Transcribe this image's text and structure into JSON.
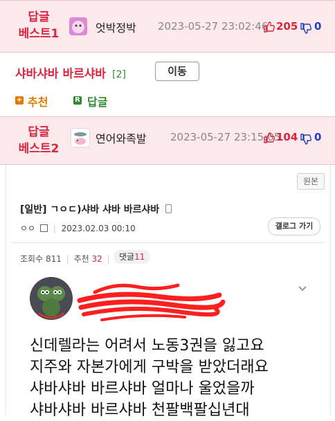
{
  "best1": {
    "label_line1": "답글",
    "label_line2": "베스트1",
    "nickname": "엇박정박",
    "datetime": "2023-05-27 23:02:46",
    "up": "205",
    "down": "0"
  },
  "thread": {
    "title": "샤바샤바 바르샤바",
    "reply_count": "[2]",
    "move_button": "이동",
    "recommend_label": "추천",
    "reply_label": "답글",
    "recommend_badge": "+",
    "reply_badge": "R"
  },
  "best2": {
    "label_line1": "답글",
    "label_line2": "베스트2",
    "nickname": "연어와족발",
    "datetime": "2023-05-27 23:15:05",
    "up": "104",
    "down": "0"
  },
  "post": {
    "original_button": "원본",
    "title": "[일반] ㄱㅇㄷ)샤바 샤바 바르샤바",
    "author": "ㅇㅇ",
    "date": "2023.02.03 00:10",
    "gallery_button": "갤로그 가기",
    "views_label": "조회수",
    "views": "811",
    "recommend_label": "추천",
    "recommend": "32",
    "comments_label": "댓글",
    "comments": "11",
    "lines": [
      "신데렐라는 어려서 노동3권을 잃고요",
      "지주와 자본가에게 구박을 받았더래요",
      "샤바샤바 바르샤바 얼마나 울었을까",
      "샤바샤바 바르샤바 천팔백팔십년대"
    ]
  },
  "colors": {
    "best_bg": "#fde9ec",
    "best_text": "#d9263f",
    "down_blue": "#1f3fbf",
    "recommend_orange": "#e07b00",
    "reply_green": "#2e8b2e"
  },
  "icons": [
    "thumbs-up-icon",
    "thumbs-down-icon",
    "mobile-icon",
    "chevron-down-icon",
    "image-icon"
  ]
}
